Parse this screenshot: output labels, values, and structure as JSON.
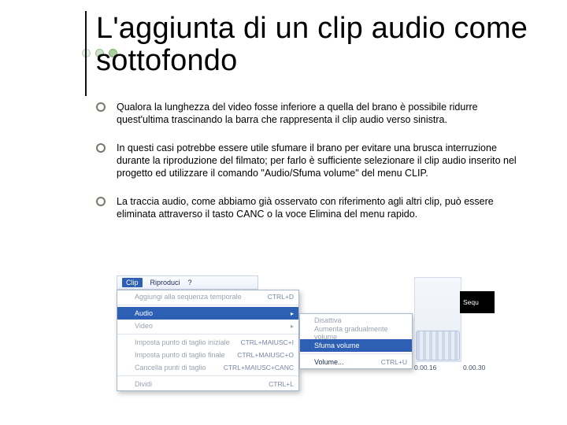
{
  "title": "L'aggiunta di un clip audio come sottofondo",
  "bullets": [
    "Qualora la lunghezza del video fosse inferiore a quella del brano è possibile ridurre quest'ultima trascinando la barra che rappresenta il clip audio verso sinistra.",
    "In questi casi potrebbe essere utile sfumare il brano per evitare una brusca interruzione durante la riproduzione del filmato; per farlo è sufficiente selezionare il clip audio inserito nel progetto ed utilizzare il comando \"Audio/Sfuma volume\" del menu CLIP.",
    "La traccia audio, come abbiamo già osservato con riferimento agli  altri clip, può essere eliminata attraverso il tasto CANC o la voce Elimina del menu rapido."
  ],
  "screenshot": {
    "menubar": {
      "clip": "Clip",
      "riproduci": "Riproduci",
      "help": "?"
    },
    "dropdown": {
      "aggiungi": {
        "label": "Aggiungi alla sequenza temporale",
        "shortcut": "CTRL+D"
      },
      "audio": "Audio",
      "video": "Video",
      "imposta_iniziale": {
        "label": "Imposta punto di taglio iniziale",
        "shortcut": "CTRL+MAIUSC+I"
      },
      "imposta_finale": {
        "label": "Imposta punto di taglio finale",
        "shortcut": "CTRL+MAIUSC+O"
      },
      "cancella": {
        "label": "Cancella punti di taglio",
        "shortcut": "CTRL+MAIUSC+CANC"
      },
      "combina": {
        "label": "Dividi",
        "shortcut": "CTRL+L"
      }
    },
    "submenu": {
      "disattiva": "Disattiva",
      "aumenta": "Aumenta gradualmente volume",
      "sfuma": "Sfuma volume",
      "volume": {
        "label": "Volume...",
        "shortcut": "CTRL+U"
      }
    },
    "timeline": {
      "t1": "0.00.16",
      "t2": "0.00.30",
      "seq_label": "Sequ"
    }
  }
}
